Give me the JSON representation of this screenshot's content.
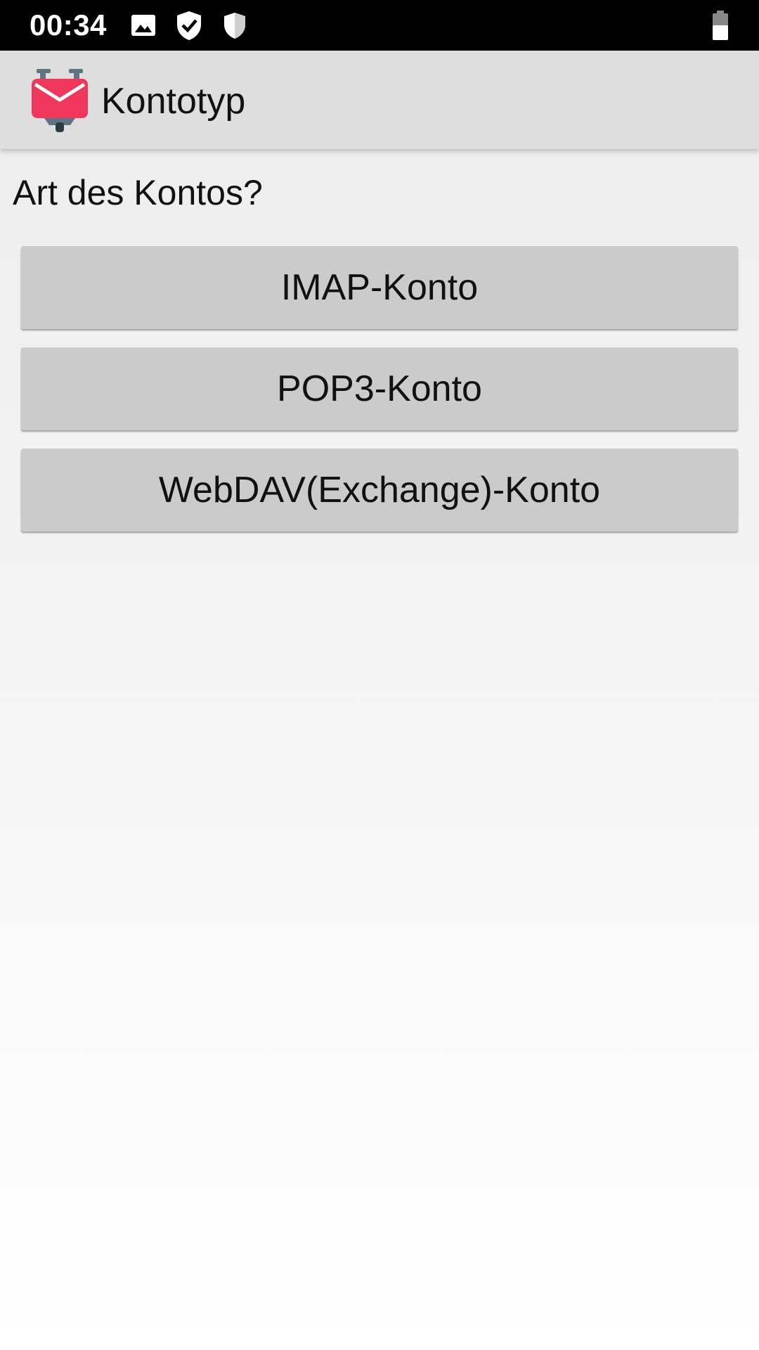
{
  "status_bar": {
    "time": "00:34",
    "icons": [
      "image-icon",
      "shield-check-icon",
      "shield-icon",
      "battery-icon"
    ]
  },
  "app_bar": {
    "title": "Kontotyp",
    "logo_icon": "k9-mail-logo-icon"
  },
  "content": {
    "question": "Art des Kontos?",
    "buttons": [
      {
        "label": "IMAP-Konto"
      },
      {
        "label": "POP3-Konto"
      },
      {
        "label": "WebDAV(Exchange)-Konto"
      }
    ]
  },
  "colors": {
    "status_bar": "#000000",
    "app_bar": "#dedede",
    "button": "#cbcbcb",
    "logo_red": "#f0365a"
  }
}
